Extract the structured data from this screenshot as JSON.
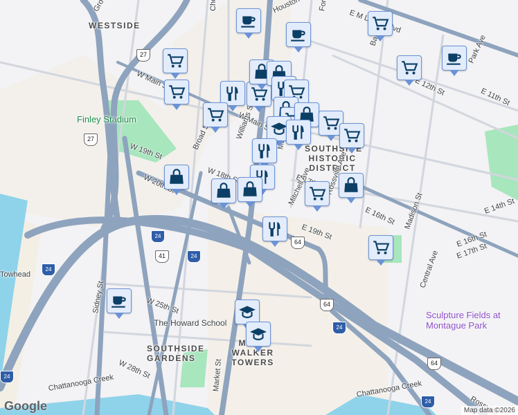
{
  "map": {
    "neighborhoods": [
      "WESTSIDE",
      "SOUTHSIDE HISTORIC DISTRICT",
      "SOUTHSIDE GARDENS",
      "MARY WALKER TOWERS"
    ],
    "pois": {
      "stadium": "Finley Stadium",
      "school": "The Howard School",
      "park": "Sculpture Fields at Montague Park",
      "towhead": "Towhead"
    },
    "streets": [
      "W Main St",
      "W Main St",
      "W 19th St",
      "W 20th St",
      "Broad St",
      "Williams St",
      "W 18th St",
      "Chestnut St",
      "Houston St",
      "Grove St",
      "E M L King Blvd",
      "Baldwin St",
      "Park Ave",
      "E 11th St",
      "E 12th St",
      "E 17th St",
      "Mitchell Ave",
      "Rossville Ave",
      "E 16th St",
      "E 14th St",
      "Madison St",
      "E 19th St",
      "Central Ave",
      "E 17th St",
      "E 16th St",
      "W 25th St",
      "W 28th St",
      "Sidney St",
      "Market St",
      "Chattanooga Creek",
      "Chattanooga Creek",
      "Rossville",
      "Fort St",
      "Market St"
    ],
    "shields": [
      "27",
      "27",
      "24",
      "41",
      "24",
      "64",
      "64",
      "24",
      "64",
      "24",
      "24",
      "24"
    ],
    "markers": [
      "coffee",
      "coffee",
      "cart",
      "cart",
      "coffee",
      "cart",
      "cart",
      "fork",
      "cart",
      "cart",
      "bag",
      "bag",
      "fork",
      "cart",
      "bag",
      "cart",
      "bag",
      "cart",
      "cart",
      "grad",
      "fork",
      "fork",
      "fork",
      "bag",
      "bag",
      "bag",
      "cart",
      "bag",
      "fork",
      "cart",
      "coffee",
      "grad",
      "grad"
    ]
  },
  "footer": {
    "logo": "Google",
    "attribution": "Map data ©2026"
  },
  "colors": {
    "road": "#8ea3bd",
    "water": "#8fd3ea",
    "park": "#a8e6bd",
    "marker_bg": "#e3ecfb",
    "marker_icon": "#0c3f66"
  }
}
